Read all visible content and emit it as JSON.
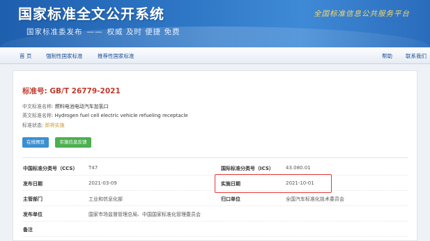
{
  "banner": {
    "title": "国家标准全文公开系统",
    "subtitle_left": "国家标准委发布",
    "subtitle_sep": "——",
    "subtitle_right": "权威 及时 便捷 免费",
    "platform": "全国标准信息公共服务平台"
  },
  "nav": {
    "home": "首 页",
    "mandatory": "强制性国家标准",
    "recommended": "推荐性国家标准",
    "help": "帮助",
    "contact": "联系我们"
  },
  "standard": {
    "number_label": "标准号:",
    "number": "GB/T 26779-2021",
    "cn_name_label": "中文标准名称:",
    "cn_name": "燃料电池电动汽车加氢口",
    "en_name_label": "英文标准名称:",
    "en_name": "Hydrogen fuel cell electric vehicle refueling receptacle",
    "status_label": "标准状态:",
    "status": "即将实施"
  },
  "buttons": {
    "preview": "在线预览",
    "feedback": "实施信息反馈"
  },
  "info": {
    "ccs_label": "中国标准分类号（CCS）",
    "ccs": "T47",
    "ics_label": "国际标准分类号（ICS）",
    "ics": "43.080.01",
    "publish_label": "发布日期",
    "publish": "2021-03-09",
    "effective_label": "实施日期",
    "effective": "2021-10-01",
    "dept_label": "主管部门",
    "dept": "工业和信息化部",
    "owner_label": "归口单位",
    "owner": "全国汽车标准化技术委员会",
    "issuer_label": "发布单位",
    "issuer": "国家市场监督管理总局、中国国家标准化管理委员会",
    "remark_label": "备注"
  },
  "colors": {
    "banner_blue": "#2f78c7",
    "std_no_red": "#c0392b",
    "highlight_red": "#e53935",
    "button_blue": "#3b8fcf",
    "button_green": "#4caf50",
    "status_gold": "#c89a2e"
  }
}
